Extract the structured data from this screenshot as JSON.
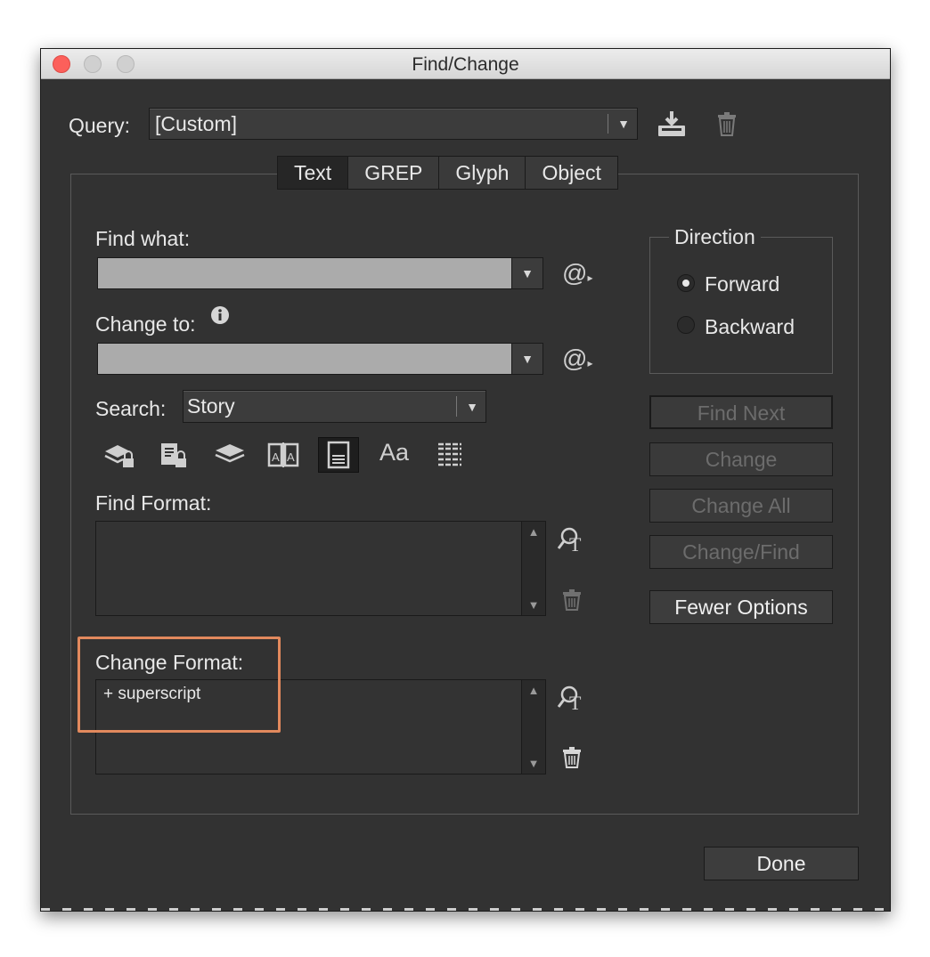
{
  "window": {
    "title": "Find/Change"
  },
  "query": {
    "label": "Query:",
    "value": "[Custom]"
  },
  "tabs": [
    {
      "label": "Text",
      "active": true
    },
    {
      "label": "GREP",
      "active": false
    },
    {
      "label": "Glyph",
      "active": false
    },
    {
      "label": "Object",
      "active": false
    }
  ],
  "find_what": {
    "label": "Find what:",
    "value": ""
  },
  "change_to": {
    "label": "Change to:",
    "value": ""
  },
  "search": {
    "label": "Search:",
    "value": "Story"
  },
  "option_icons": {
    "case_sensitive_label": "Aa"
  },
  "find_format": {
    "label": "Find Format:",
    "value": ""
  },
  "change_format": {
    "label": "Change Format:",
    "value": "+ superscript"
  },
  "direction": {
    "legend": "Direction",
    "forward": "Forward",
    "backward": "Backward",
    "selected": "Forward"
  },
  "buttons": {
    "find_next": "Find Next",
    "change": "Change",
    "change_all": "Change All",
    "change_find": "Change/Find",
    "fewer_options": "Fewer Options",
    "done": "Done"
  },
  "colors": {
    "panel": "#323232",
    "highlight": "#e2895d",
    "close": "#fc605b"
  }
}
